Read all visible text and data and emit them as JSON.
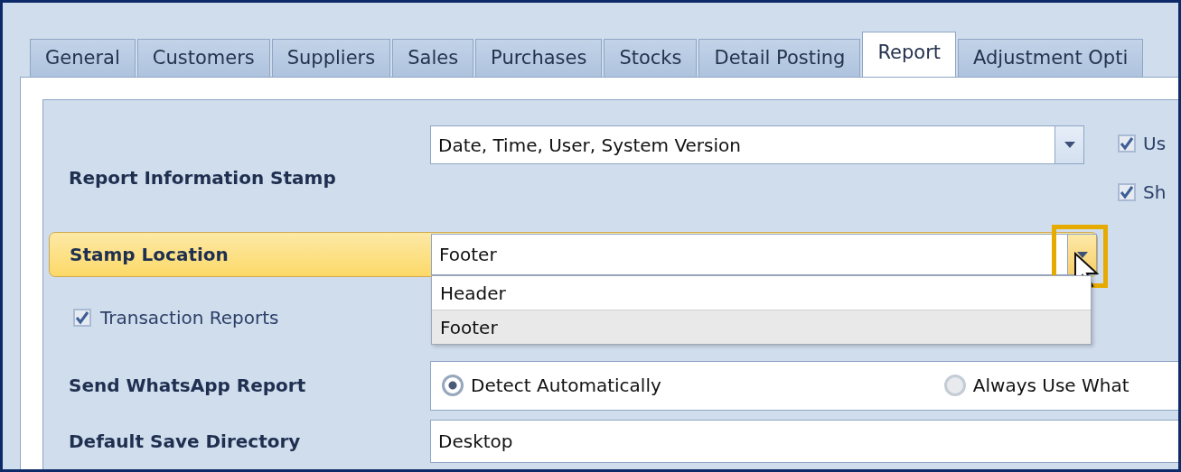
{
  "tabs": [
    {
      "label": "General",
      "selected": false
    },
    {
      "label": "Customers",
      "selected": false
    },
    {
      "label": "Suppliers",
      "selected": false
    },
    {
      "label": "Sales",
      "selected": false
    },
    {
      "label": "Purchases",
      "selected": false
    },
    {
      "label": "Stocks",
      "selected": false
    },
    {
      "label": "Detail Posting",
      "selected": false
    },
    {
      "label": "Report",
      "selected": true
    },
    {
      "label": "Adjustment Opti",
      "selected": false
    }
  ],
  "report_information_stamp": {
    "label": "Report Information Stamp",
    "value": "Date, Time, User, System Version",
    "options": [
      {
        "label": "Us",
        "checked": true
      },
      {
        "label": "Sh",
        "checked": true
      }
    ]
  },
  "stamp_location": {
    "label": "Stamp Location",
    "value": "Footer",
    "highlighted": true,
    "dropdown_items": [
      {
        "label": "Header",
        "selected": false
      },
      {
        "label": "Footer",
        "selected": true
      }
    ]
  },
  "transaction_reports": {
    "label": "Transaction Reports",
    "checked": true
  },
  "send_whatsapp_report": {
    "label": "Send WhatsApp Report",
    "options": [
      {
        "label": "Detect Automatically",
        "selected": true
      },
      {
        "label": "Always Use What",
        "selected": false
      }
    ]
  },
  "default_save_directory": {
    "label": "Default Save Directory",
    "value": "Desktop"
  }
}
